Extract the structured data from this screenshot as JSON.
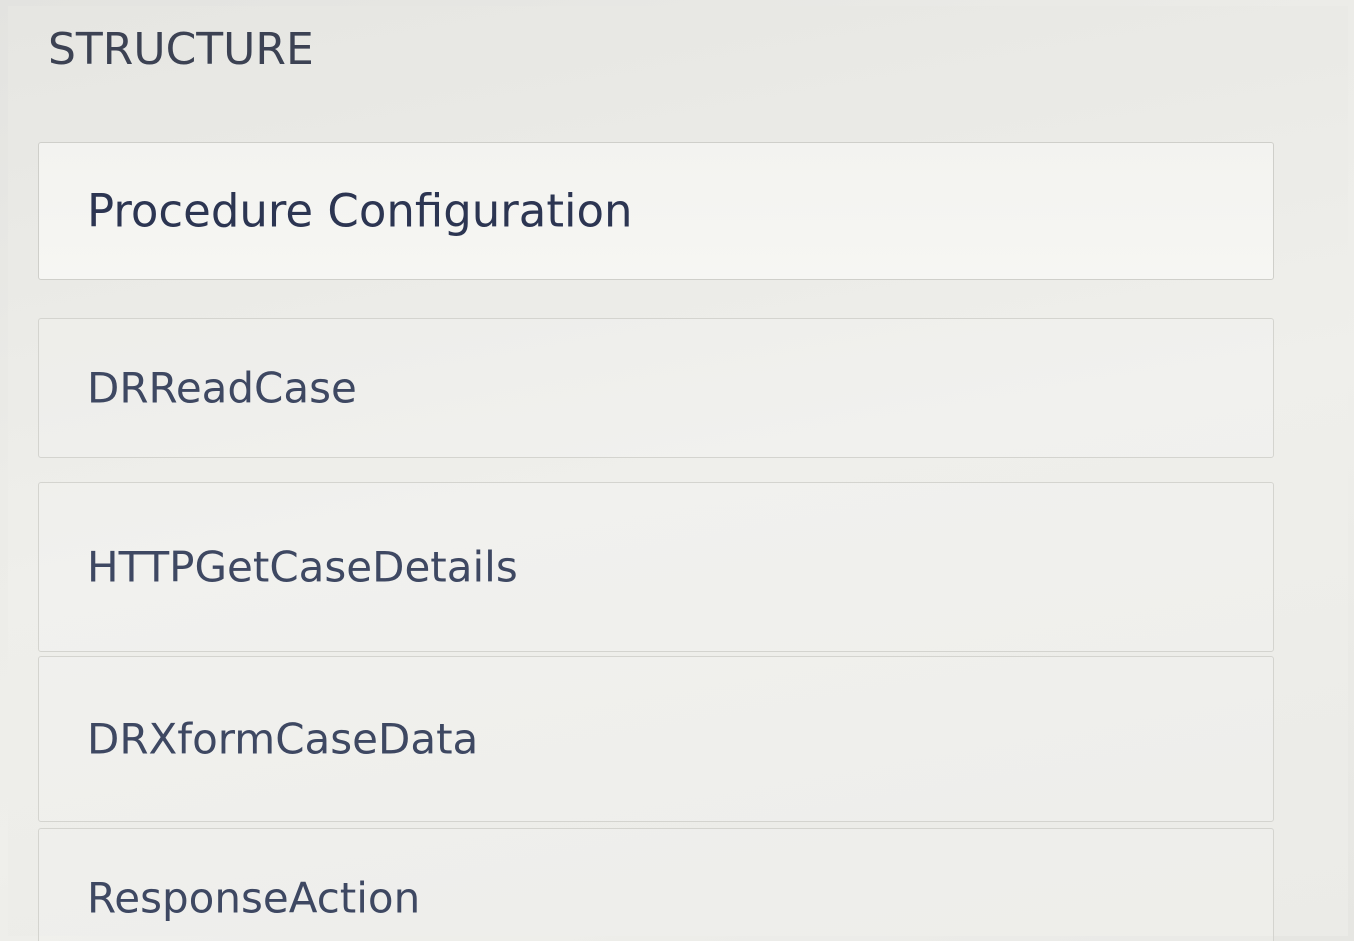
{
  "structure": {
    "title": "STRUCTURE",
    "items": [
      {
        "label": "Procedure Configuration"
      },
      {
        "label": "DRReadCase"
      },
      {
        "label": "HTTPGetCaseDetails"
      },
      {
        "label": "DRXformCaseData"
      },
      {
        "label": "ResponseAction"
      }
    ]
  }
}
